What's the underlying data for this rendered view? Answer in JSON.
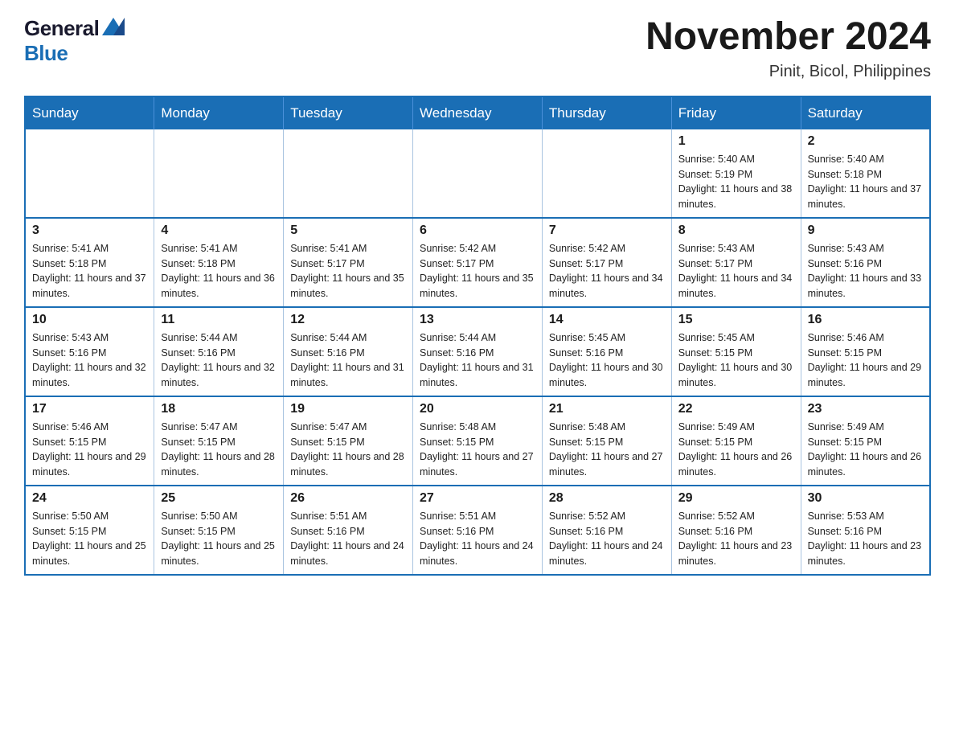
{
  "header": {
    "logo_general": "General",
    "logo_blue": "Blue",
    "main_title": "November 2024",
    "subtitle": "Pinit, Bicol, Philippines"
  },
  "calendar": {
    "days_of_week": [
      "Sunday",
      "Monday",
      "Tuesday",
      "Wednesday",
      "Thursday",
      "Friday",
      "Saturday"
    ],
    "weeks": [
      [
        {
          "day": "",
          "info": ""
        },
        {
          "day": "",
          "info": ""
        },
        {
          "day": "",
          "info": ""
        },
        {
          "day": "",
          "info": ""
        },
        {
          "day": "",
          "info": ""
        },
        {
          "day": "1",
          "info": "Sunrise: 5:40 AM\nSunset: 5:19 PM\nDaylight: 11 hours and 38 minutes."
        },
        {
          "day": "2",
          "info": "Sunrise: 5:40 AM\nSunset: 5:18 PM\nDaylight: 11 hours and 37 minutes."
        }
      ],
      [
        {
          "day": "3",
          "info": "Sunrise: 5:41 AM\nSunset: 5:18 PM\nDaylight: 11 hours and 37 minutes."
        },
        {
          "day": "4",
          "info": "Sunrise: 5:41 AM\nSunset: 5:18 PM\nDaylight: 11 hours and 36 minutes."
        },
        {
          "day": "5",
          "info": "Sunrise: 5:41 AM\nSunset: 5:17 PM\nDaylight: 11 hours and 35 minutes."
        },
        {
          "day": "6",
          "info": "Sunrise: 5:42 AM\nSunset: 5:17 PM\nDaylight: 11 hours and 35 minutes."
        },
        {
          "day": "7",
          "info": "Sunrise: 5:42 AM\nSunset: 5:17 PM\nDaylight: 11 hours and 34 minutes."
        },
        {
          "day": "8",
          "info": "Sunrise: 5:43 AM\nSunset: 5:17 PM\nDaylight: 11 hours and 34 minutes."
        },
        {
          "day": "9",
          "info": "Sunrise: 5:43 AM\nSunset: 5:16 PM\nDaylight: 11 hours and 33 minutes."
        }
      ],
      [
        {
          "day": "10",
          "info": "Sunrise: 5:43 AM\nSunset: 5:16 PM\nDaylight: 11 hours and 32 minutes."
        },
        {
          "day": "11",
          "info": "Sunrise: 5:44 AM\nSunset: 5:16 PM\nDaylight: 11 hours and 32 minutes."
        },
        {
          "day": "12",
          "info": "Sunrise: 5:44 AM\nSunset: 5:16 PM\nDaylight: 11 hours and 31 minutes."
        },
        {
          "day": "13",
          "info": "Sunrise: 5:44 AM\nSunset: 5:16 PM\nDaylight: 11 hours and 31 minutes."
        },
        {
          "day": "14",
          "info": "Sunrise: 5:45 AM\nSunset: 5:16 PM\nDaylight: 11 hours and 30 minutes."
        },
        {
          "day": "15",
          "info": "Sunrise: 5:45 AM\nSunset: 5:15 PM\nDaylight: 11 hours and 30 minutes."
        },
        {
          "day": "16",
          "info": "Sunrise: 5:46 AM\nSunset: 5:15 PM\nDaylight: 11 hours and 29 minutes."
        }
      ],
      [
        {
          "day": "17",
          "info": "Sunrise: 5:46 AM\nSunset: 5:15 PM\nDaylight: 11 hours and 29 minutes."
        },
        {
          "day": "18",
          "info": "Sunrise: 5:47 AM\nSunset: 5:15 PM\nDaylight: 11 hours and 28 minutes."
        },
        {
          "day": "19",
          "info": "Sunrise: 5:47 AM\nSunset: 5:15 PM\nDaylight: 11 hours and 28 minutes."
        },
        {
          "day": "20",
          "info": "Sunrise: 5:48 AM\nSunset: 5:15 PM\nDaylight: 11 hours and 27 minutes."
        },
        {
          "day": "21",
          "info": "Sunrise: 5:48 AM\nSunset: 5:15 PM\nDaylight: 11 hours and 27 minutes."
        },
        {
          "day": "22",
          "info": "Sunrise: 5:49 AM\nSunset: 5:15 PM\nDaylight: 11 hours and 26 minutes."
        },
        {
          "day": "23",
          "info": "Sunrise: 5:49 AM\nSunset: 5:15 PM\nDaylight: 11 hours and 26 minutes."
        }
      ],
      [
        {
          "day": "24",
          "info": "Sunrise: 5:50 AM\nSunset: 5:15 PM\nDaylight: 11 hours and 25 minutes."
        },
        {
          "day": "25",
          "info": "Sunrise: 5:50 AM\nSunset: 5:15 PM\nDaylight: 11 hours and 25 minutes."
        },
        {
          "day": "26",
          "info": "Sunrise: 5:51 AM\nSunset: 5:16 PM\nDaylight: 11 hours and 24 minutes."
        },
        {
          "day": "27",
          "info": "Sunrise: 5:51 AM\nSunset: 5:16 PM\nDaylight: 11 hours and 24 minutes."
        },
        {
          "day": "28",
          "info": "Sunrise: 5:52 AM\nSunset: 5:16 PM\nDaylight: 11 hours and 24 minutes."
        },
        {
          "day": "29",
          "info": "Sunrise: 5:52 AM\nSunset: 5:16 PM\nDaylight: 11 hours and 23 minutes."
        },
        {
          "day": "30",
          "info": "Sunrise: 5:53 AM\nSunset: 5:16 PM\nDaylight: 11 hours and 23 minutes."
        }
      ]
    ]
  }
}
